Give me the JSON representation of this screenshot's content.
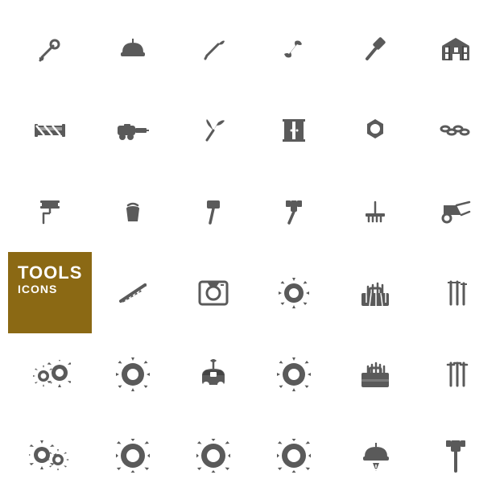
{
  "title": "Tools Icons",
  "label": {
    "main": "TOOLS",
    "sub": "ICONS"
  },
  "accent_color": "#8B6914",
  "icon_color": "#5a5a5a",
  "rows": 6,
  "cols": 6
}
